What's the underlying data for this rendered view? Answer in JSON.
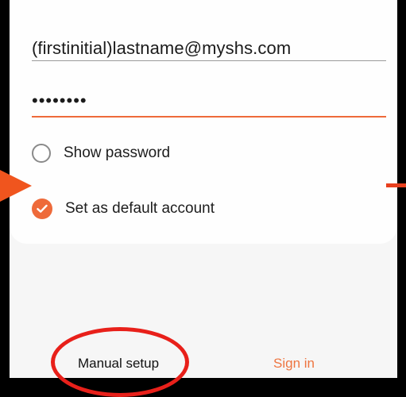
{
  "login": {
    "email_value": "(firstinitial)lastname@myshs.com",
    "password_value": "••••••••"
  },
  "options": {
    "show_password_label": "Show password",
    "show_password_checked": false,
    "default_account_label": "Set as default account",
    "default_account_checked": true
  },
  "actions": {
    "manual_setup_label": "Manual setup",
    "sign_in_label": "Sign in"
  },
  "colors": {
    "accent": "#ee6a3a",
    "annotation_red": "#e8201a",
    "arrow_orange": "#f0551e"
  },
  "icons": {
    "radio": "radio-unchecked-icon",
    "check": "checkmark-circle-icon",
    "arrow": "arrow-right-annotation-icon"
  }
}
